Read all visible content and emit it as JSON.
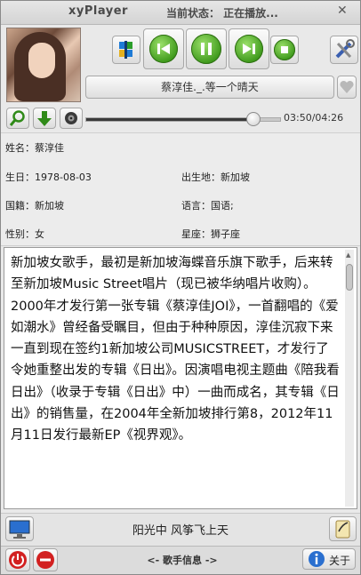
{
  "window": {
    "app_name": "xyPlayer",
    "status_text": "当前状态： 正在播放...",
    "close_glyph": "✕"
  },
  "now_playing": {
    "title": "蔡淳佳._.等一个晴天",
    "position": "03:50",
    "duration": "04:26",
    "progress_fraction": 0.864
  },
  "artist": {
    "name_label": "姓名：蔡淳佳",
    "birthday_label": "生日：1978-08-03",
    "birthplace_label": "出生地：新加坡",
    "nationality_label": "国籍：新加坡",
    "language_label": "语言：国语;",
    "gender_label": "性别：女",
    "constellation_label": "星座：狮子座"
  },
  "bio": "新加坡女歌手，最初是新加坡海蝶音乐旗下歌手，后来转至新加坡Music Street唱片（现已被华纳唱片收购）。2000年才发行第一张专辑《蔡淳佳JOI》，一首翻唱的《爱如潮水》曾经备受瞩目，但由于种种原因，淳佳沉寂下来一直到现在签约1新加坡公司MUSICSTREET，才发行了令她重整出发的专辑《日出》。因演唱电视主题曲《陪我看日出》（收录于专辑《日出》中）一曲而成名，其专辑《日出》的销售量，在2004年全新加坡排行第8，2012年11月11日发行最新EP《视界观》。",
  "lyric_line": "阳光中 风筝飞上天",
  "footer": {
    "center_label": "<- 歌手信息 ->",
    "about_label": "关于"
  },
  "icons": {
    "cover": "album-cover-photo",
    "grid": "windows-grid-icon",
    "prev": "previous-icon",
    "pause": "pause-icon",
    "next": "next-icon",
    "stop": "stop-icon",
    "settings": "tools-icon",
    "heart": "heart-icon",
    "search": "search-icon",
    "download": "download-icon",
    "speaker": "speaker-icon",
    "monitor": "monitor-icon",
    "note": "note-icon",
    "power": "power-icon",
    "minimize": "minimize-icon",
    "info": "info-icon"
  },
  "colors": {
    "accent_green": "#3f9a1c",
    "power_red": "#d22020"
  }
}
